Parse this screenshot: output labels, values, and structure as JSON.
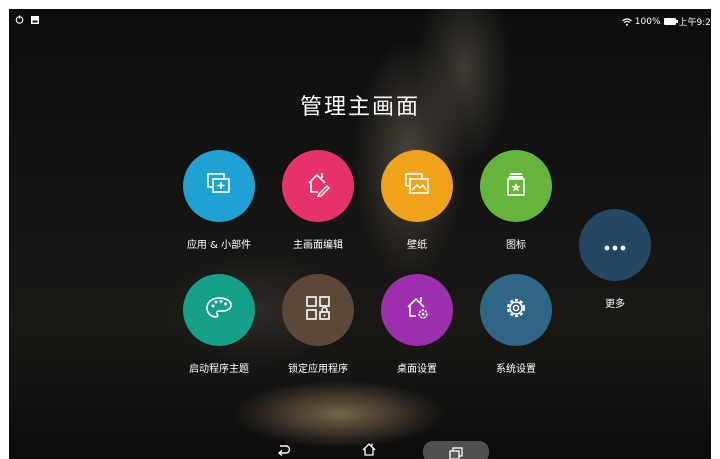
{
  "status_bar": {
    "battery_text": "100%",
    "time_text": "上午9:2",
    "left_icons": [
      "power-timer-icon",
      "image-notification-icon"
    ],
    "right_icons": [
      "wifi-icon",
      "battery-icon"
    ]
  },
  "title": "管理主画面",
  "tiles": [
    {
      "label": "应用 & 小部件",
      "color": "#1fa1d3",
      "icon": "widgets-icon"
    },
    {
      "label": "主画面编辑",
      "color": "#e8336a",
      "icon": "home-edit-icon"
    },
    {
      "label": "壁纸",
      "color": "#f0a21c",
      "icon": "wallpaper-icon"
    },
    {
      "label": "图标",
      "color": "#65b43c",
      "icon": "icon-pack-icon"
    },
    {
      "label": "更多",
      "color": "#244863",
      "icon": "more-dots-icon"
    },
    {
      "label": "启动程序主题",
      "color": "#15a08a",
      "icon": "palette-icon"
    },
    {
      "label": "锁定应用程序",
      "color": "#5b4838",
      "icon": "app-lock-icon"
    },
    {
      "label": "桌面设置",
      "color": "#9b2fae",
      "icon": "home-settings-icon"
    },
    {
      "label": "系统设置",
      "color": "#2f6585",
      "icon": "gear-icon"
    }
  ],
  "nav_bar": {
    "icons": [
      "back-icon",
      "home-icon",
      "recent-apps-icon"
    ]
  }
}
